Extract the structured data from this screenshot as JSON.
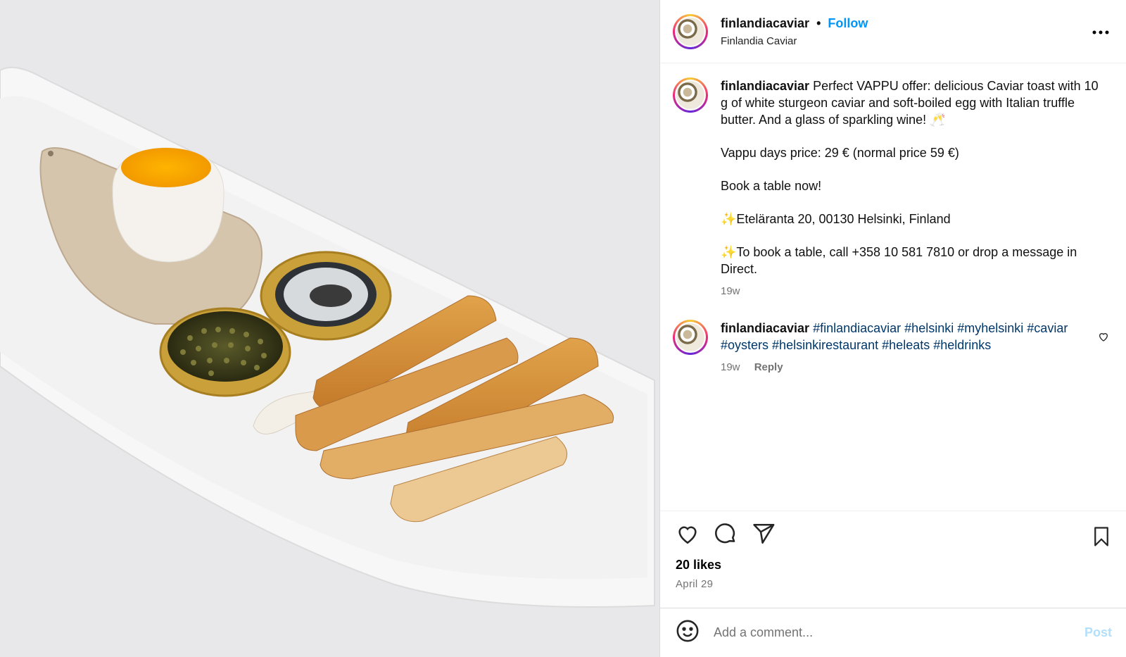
{
  "post": {
    "image_alt": "Caviar toast with soft-boiled egg on white plate",
    "header": {
      "username": "finlandiacaviar",
      "separator": "•",
      "follow_label": "Follow",
      "subtitle": "Finlandia Caviar",
      "more_label": "..."
    },
    "caption": {
      "username": "finlandiacaviar",
      "line1": "Perfect VAPPU offer: delicious Caviar toast with 10 g of white sturgeon caviar and soft-boiled egg with Italian truffle butter. And a glass of sparkling wine! 🥂",
      "line2": "Vappu days price: 29 € (normal price 59 €)",
      "line3": "Book a table now!",
      "line4": "✨Eteläranta 20, 00130 Helsinki, Finland",
      "line5": "✨To book a table, call +358 10 581 7810 or drop a message in Direct.",
      "time": "19w"
    },
    "comment": {
      "username": "finlandiacaviar",
      "hashtags": [
        "#finlandiacaviar",
        "#helsinki",
        "#myhelsinki",
        "#caviar",
        "#oysters",
        "#helsinkirestaurant",
        "#heleats",
        "#heldrinks"
      ],
      "time": "19w",
      "reply_label": "Reply"
    },
    "likes": "20 likes",
    "date": "April 29",
    "add_comment_placeholder": "Add a comment...",
    "post_label": "Post"
  },
  "icons": {
    "like": "heart-icon",
    "comment": "comment-bubble-icon",
    "share": "paper-plane-icon",
    "save": "bookmark-icon",
    "emoji": "emoji-smiley-icon",
    "comment_like": "small-heart-icon"
  },
  "colors": {
    "link": "#0095f6",
    "hashtag": "#00376b",
    "muted": "#737373",
    "post_disabled": "#b2dffc"
  }
}
